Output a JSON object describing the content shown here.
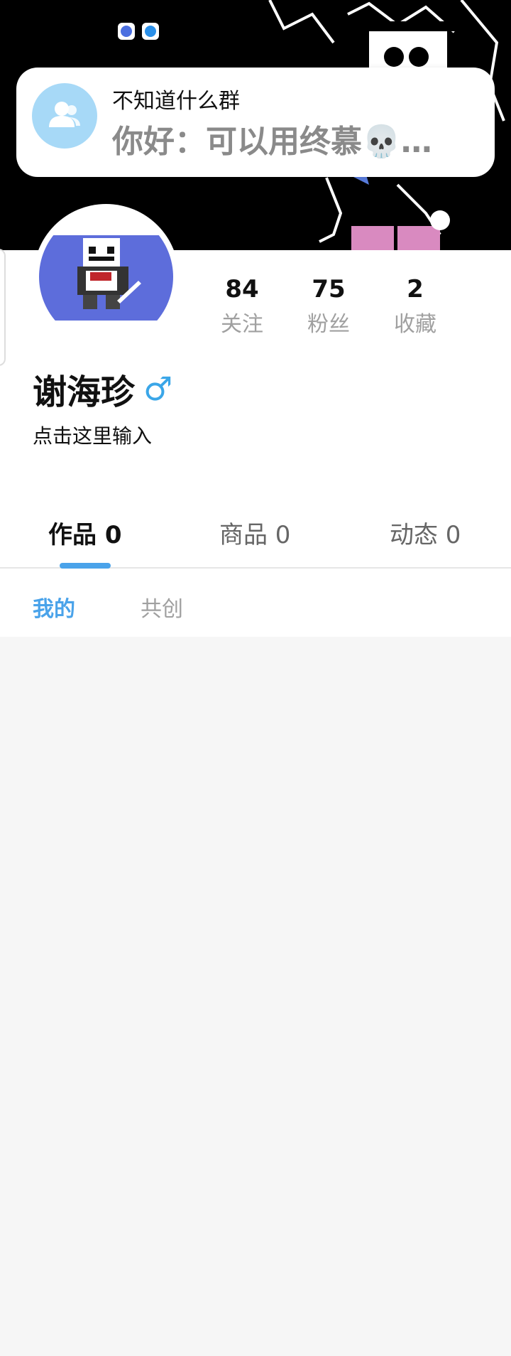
{
  "notification": {
    "title": "不知道什么群",
    "message": "你好：可以用终慕💀…"
  },
  "profile": {
    "name": "谢海珍",
    "gender_symbol": "♂",
    "bio": "点击这里输入"
  },
  "stats": [
    {
      "value": "84",
      "label": "关注"
    },
    {
      "value": "75",
      "label": "粉丝"
    },
    {
      "value": "2",
      "label": "收藏"
    }
  ],
  "tabs": [
    {
      "label": "作品 0",
      "active": true
    },
    {
      "label": "商品 0",
      "active": false
    },
    {
      "label": "动态 0",
      "active": false
    }
  ],
  "subtabs": [
    {
      "label": "我的",
      "active": true
    },
    {
      "label": "共创",
      "active": false
    }
  ],
  "colors": {
    "accent": "#4aa3ea",
    "banner_bg": "#000000",
    "avatar_bg": "#5d6ddb",
    "page_bg": "#f6f6f6"
  }
}
